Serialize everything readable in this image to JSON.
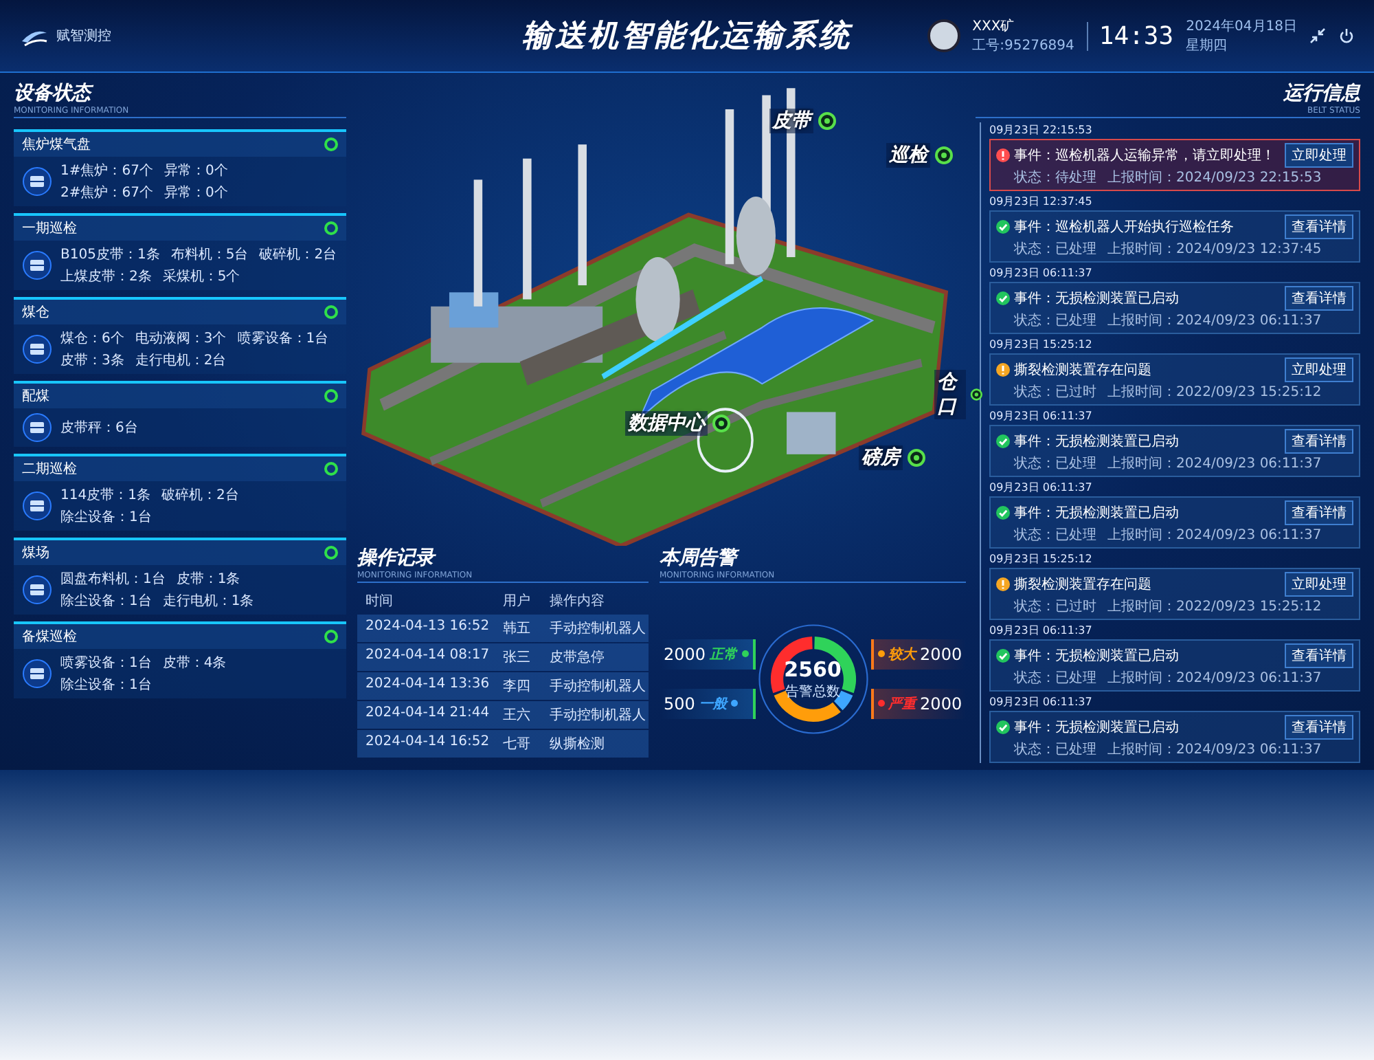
{
  "header": {
    "logo_text": "赋智测控",
    "title": "输送机智能化运输系统",
    "user": {
      "name": "XXX矿",
      "id": "工号:95276894"
    },
    "clock": {
      "time": "14:33",
      "date": "2024年04月18日",
      "weekday": "星期四"
    }
  },
  "equipment": {
    "title": "设备状态",
    "subtitle": "MONITORING INFORMATION",
    "cards": [
      {
        "title": "焦炉煤气盘",
        "online": true,
        "lines": [
          [
            "1#焦炉：67个",
            "异常：0个"
          ],
          [
            "2#焦炉：67个",
            "异常：0个"
          ]
        ]
      },
      {
        "title": "一期巡检",
        "online": true,
        "lines": [
          [
            "B105皮带：1条",
            "布料机：5台",
            "破碎机：2台"
          ],
          [
            "上煤皮带：2条",
            "采煤机：5个"
          ]
        ]
      },
      {
        "title": "煤仓",
        "online": true,
        "lines": [
          [
            "煤仓：6个",
            "电动液阀：3个",
            "喷雾设备：1台"
          ],
          [
            "皮带：3条",
            "走行电机：2台"
          ]
        ]
      },
      {
        "title": "配煤",
        "online": true,
        "lines": [
          [
            "皮带秤：6台"
          ]
        ]
      },
      {
        "title": "二期巡检",
        "online": true,
        "lines": [
          [
            "114皮带：1条",
            "破碎机：2台"
          ],
          [
            "除尘设备：1台"
          ]
        ]
      },
      {
        "title": "煤场",
        "online": true,
        "lines": [
          [
            "圆盘布料机：1台",
            "皮带：1条"
          ],
          [
            "除尘设备：1台",
            "走行电机：1条"
          ]
        ]
      },
      {
        "title": "备煤巡检",
        "online": true,
        "lines": [
          [
            "喷雾设备：1台",
            "皮带：4条"
          ],
          [
            "除尘设备：1台"
          ]
        ]
      }
    ]
  },
  "map_labels": [
    {
      "label": "皮带"
    },
    {
      "label": "巡检"
    },
    {
      "label": "数据中心"
    },
    {
      "label": "仓口"
    },
    {
      "label": "磅房"
    }
  ],
  "operations": {
    "title": "操作记录",
    "subtitle": "MONITORING INFORMATION",
    "columns": [
      "时间",
      "用户",
      "操作内容"
    ],
    "rows": [
      [
        "2024-04-13  16:52",
        "韩五",
        "手动控制机器人"
      ],
      [
        "2024-04-14  08:17",
        "张三",
        "皮带急停"
      ],
      [
        "2024-04-14  13:36",
        "李四",
        "手动控制机器人"
      ],
      [
        "2024-04-14  21:44",
        "王六",
        "手动控制机器人"
      ],
      [
        "2024-04-14  16:52",
        "七哥",
        "纵撕检测"
      ]
    ]
  },
  "alarm": {
    "title": "本周告警",
    "subtitle": "MONITORING INFORMATION",
    "total": "2560",
    "total_label": "告警总数",
    "levels": [
      {
        "label": "正常",
        "value": "2000",
        "color": "#2fd35a"
      },
      {
        "label": "一般",
        "value": "500",
        "color": "#3ea6ff"
      },
      {
        "label": "较大",
        "value": "2000",
        "color": "#ff9d0a"
      },
      {
        "label": "严重",
        "value": "2000",
        "color": "#ff2d2d"
      }
    ]
  },
  "events": {
    "title": "运行信息",
    "subtitle": "BELT STATUS",
    "items": [
      {
        "time": "09月23日  22:15:53",
        "kind": "alarm",
        "text": "事件：巡检机器人运输异常，请立即处理！",
        "status": "状态：待处理",
        "report": "上报时间：2024/09/23 22:15:53",
        "button": "立即处理"
      },
      {
        "time": "09月23日  12:37:45",
        "kind": "done",
        "text": "事件：巡检机器人开始执行巡检任务",
        "status": "状态：已处理",
        "report": "上报时间：2024/09/23 12:37:45",
        "button": "查看详情"
      },
      {
        "time": "09月23日  06:11:37",
        "kind": "done",
        "text": "事件：无损检测装置已启动",
        "status": "状态：已处理",
        "report": "上报时间：2024/09/23 06:11:37",
        "button": "查看详情"
      },
      {
        "time": "09月23日  15:25:12",
        "kind": "warning",
        "text": "撕裂检测装置存在问题",
        "status": "状态：已过时",
        "report": "上报时间：2022/09/23 15:25:12",
        "button": "立即处理"
      },
      {
        "time": "09月23日  06:11:37",
        "kind": "done",
        "text": "事件：无损检测装置已启动",
        "status": "状态：已处理",
        "report": "上报时间：2024/09/23 06:11:37",
        "button": "查看详情"
      },
      {
        "time": "09月23日  06:11:37",
        "kind": "done",
        "text": "事件：无损检测装置已启动",
        "status": "状态：已处理",
        "report": "上报时间：2024/09/23 06:11:37",
        "button": "查看详情"
      },
      {
        "time": "09月23日  15:25:12",
        "kind": "warning",
        "text": "撕裂检测装置存在问题",
        "status": "状态：已过时",
        "report": "上报时间：2022/09/23 15:25:12",
        "button": "立即处理"
      },
      {
        "time": "09月23日  06:11:37",
        "kind": "done",
        "text": "事件：无损检测装置已启动",
        "status": "状态：已处理",
        "report": "上报时间：2024/09/23 06:11:37",
        "button": "查看详情"
      },
      {
        "time": "09月23日  06:11:37",
        "kind": "done",
        "text": "事件：无损检测装置已启动",
        "status": "状态：已处理",
        "report": "上报时间：2024/09/23 06:11:37",
        "button": "查看详情"
      }
    ]
  }
}
